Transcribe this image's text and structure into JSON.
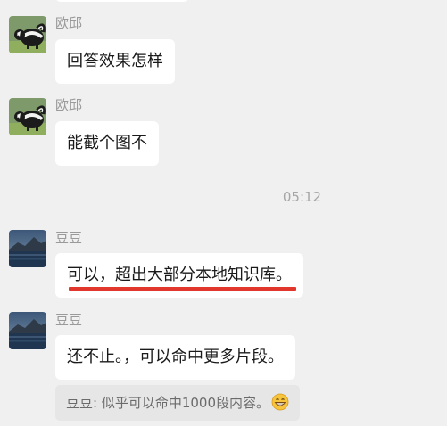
{
  "messages": [
    {
      "sender": "欧邱",
      "text": "回答效果怎样",
      "avatar": "skunk-avatar"
    },
    {
      "sender": "欧邱",
      "text": "能截个图不",
      "avatar": "skunk-avatar"
    },
    {
      "sender": "豆豆",
      "text": "可以，超出大部分本地知识库。",
      "avatar": "lake-avatar",
      "highlight_color": "#e0362c"
    },
    {
      "sender": "豆豆",
      "text": "还不止。，可以命中更多片段。",
      "avatar": "lake-avatar"
    }
  ],
  "timestamp": "05:12",
  "quote": {
    "text": "豆豆: 似乎可以命中1000段内容。",
    "emoji": "grinning-face-emoji"
  },
  "colors": {
    "background": "#f0f0f0",
    "bubble": "#ffffff",
    "quote_bg": "#e6e6e6",
    "highlight": "#e0362c"
  }
}
